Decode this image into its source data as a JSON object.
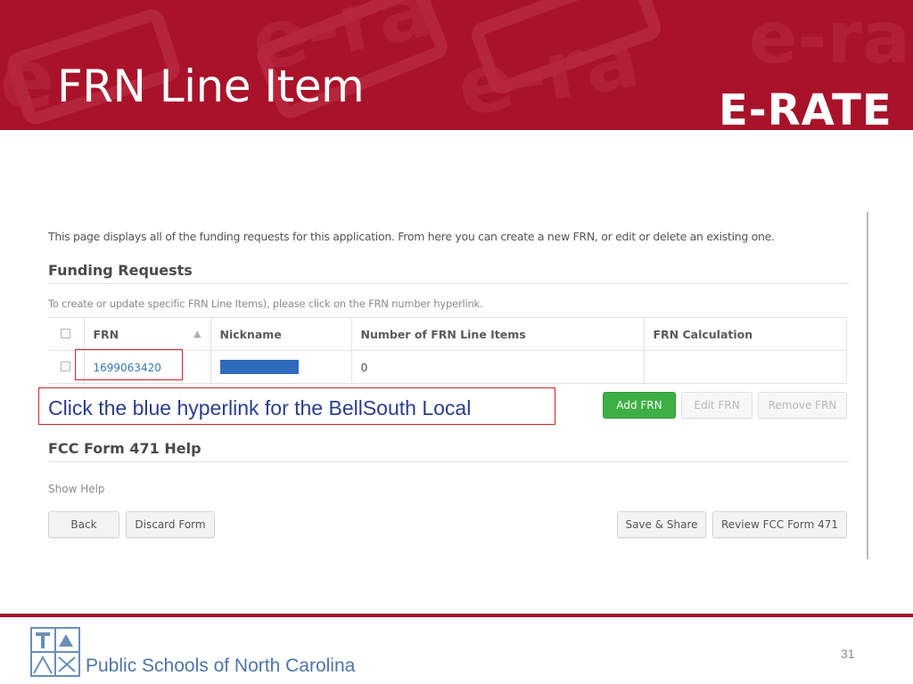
{
  "slide": {
    "title": "FRN Line Item",
    "brand": "E-RATE",
    "page_number": "31"
  },
  "screen": {
    "intro": "This page displays all of the funding requests for this application. From here you can create a new FRN, or edit or delete an existing one.",
    "funding_heading": "Funding Requests",
    "hint": "To create or update specific FRN Line Items), please click on the FRN number hyperlink.",
    "table": {
      "columns": [
        "FRN",
        "Nickname",
        "Number of FRN Line Items",
        "FRN Calculation"
      ],
      "rows": [
        {
          "frn": "1699063420",
          "nickname": "",
          "line_items": "0",
          "calculation": ""
        }
      ]
    },
    "buttons": {
      "add_frn": "Add FRN",
      "edit_frn": "Edit FRN",
      "remove_frn": "Remove FRN",
      "back": "Back",
      "discard": "Discard Form",
      "save_share": "Save & Share",
      "review": "Review FCC Form 471"
    },
    "help_heading": "FCC Form 471 Help",
    "show_help": "Show Help"
  },
  "callout": {
    "text": "Click the blue hyperlink for the BellSouth Local"
  },
  "footer": {
    "org": "Public Schools of North Carolina"
  },
  "colors": {
    "banner": "#a8132a",
    "link": "#3778b5",
    "primary_button": "#3eaf45",
    "callout_border": "#d2232a",
    "callout_text": "#2b3e8c",
    "nickname_redaction": "#2f6bbd"
  },
  "icons": {
    "sort": "sort-triangle-icon",
    "checkbox": "checkbox-icon",
    "footer_logo": "nc-schools-logo-icon"
  }
}
